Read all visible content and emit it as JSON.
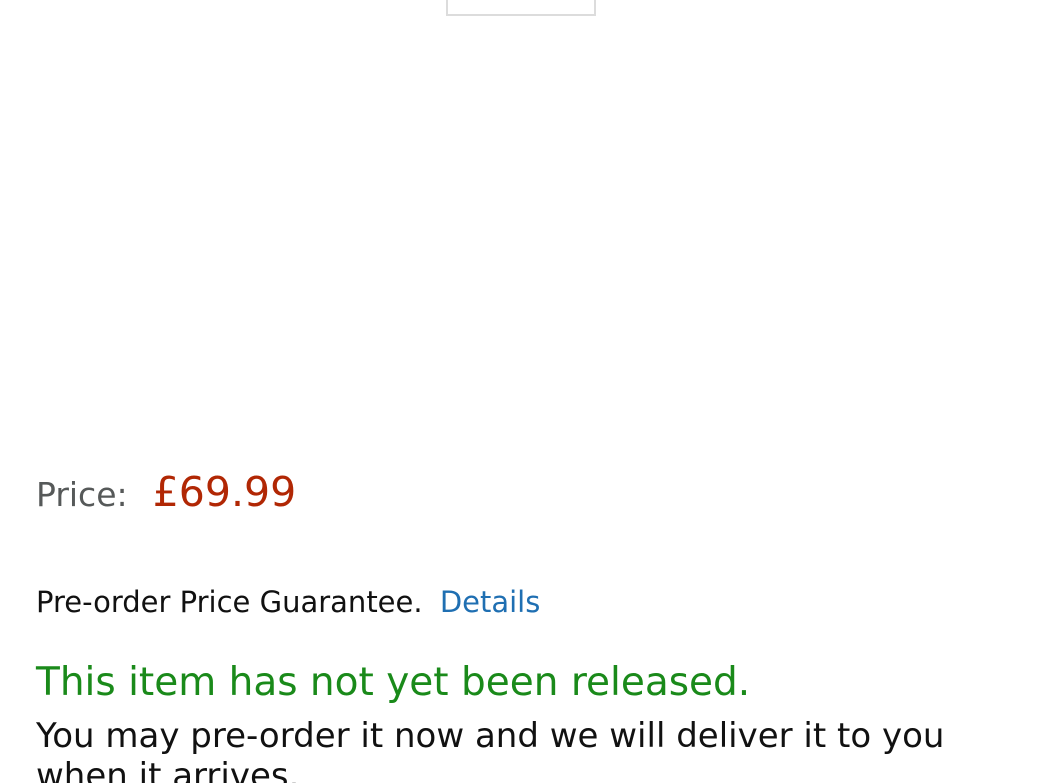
{
  "product_image": {
    "icon": "product-image-thumbnail"
  },
  "price": {
    "label": "Price:",
    "value": "£69.99",
    "color": "#b12704"
  },
  "guarantee": {
    "text": "Pre-order Price Guarantee.",
    "link_label": "Details",
    "link_color": "#1f6fb2"
  },
  "availability": {
    "status": "This item has not yet been released.",
    "status_color": "#1a8a1a",
    "note": "You may pre-order it now and we will deliver it to you when it arrives."
  }
}
